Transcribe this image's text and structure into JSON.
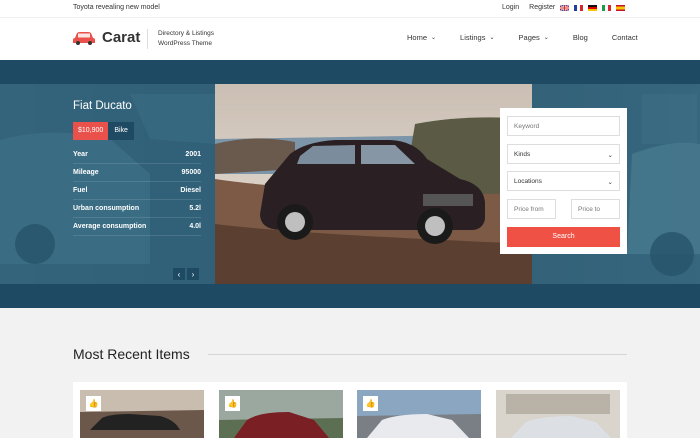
{
  "topbar": {
    "news": "Toyota revealing new model",
    "login": "Login",
    "register": "Register",
    "flags": [
      "uk-flag",
      "fr-flag",
      "de-flag",
      "it-flag",
      "es-flag"
    ]
  },
  "header": {
    "logo": "Carat",
    "tagline_line1": "Directory & Listings",
    "tagline_line2": "WordPress Theme",
    "nav": [
      {
        "label": "Home",
        "dropdown": true
      },
      {
        "label": "Listings",
        "dropdown": true
      },
      {
        "label": "Pages",
        "dropdown": true
      },
      {
        "label": "Blog",
        "dropdown": false
      },
      {
        "label": "Contact",
        "dropdown": false
      }
    ]
  },
  "hero": {
    "title": "Fiat Ducato",
    "price": "$10,900",
    "type": "Bike",
    "specs": [
      {
        "label": "Year",
        "value": "2001"
      },
      {
        "label": "Mileage",
        "value": "95000"
      },
      {
        "label": "Fuel",
        "value": "Diesel"
      },
      {
        "label": "Urban consumption",
        "value": "5.2l"
      },
      {
        "label": "Average consumption",
        "value": "4.0l"
      }
    ],
    "prev": "‹",
    "next": "›"
  },
  "search": {
    "keyword_placeholder": "Keyword",
    "kinds": "Kinds",
    "locations": "Locations",
    "price_from": "Price from",
    "price_to": "Price to",
    "button": "Search"
  },
  "recent": {
    "title": "Most Recent Items"
  },
  "colors": {
    "accent": "#ef5245",
    "hero_dark": "#1f4a63"
  }
}
